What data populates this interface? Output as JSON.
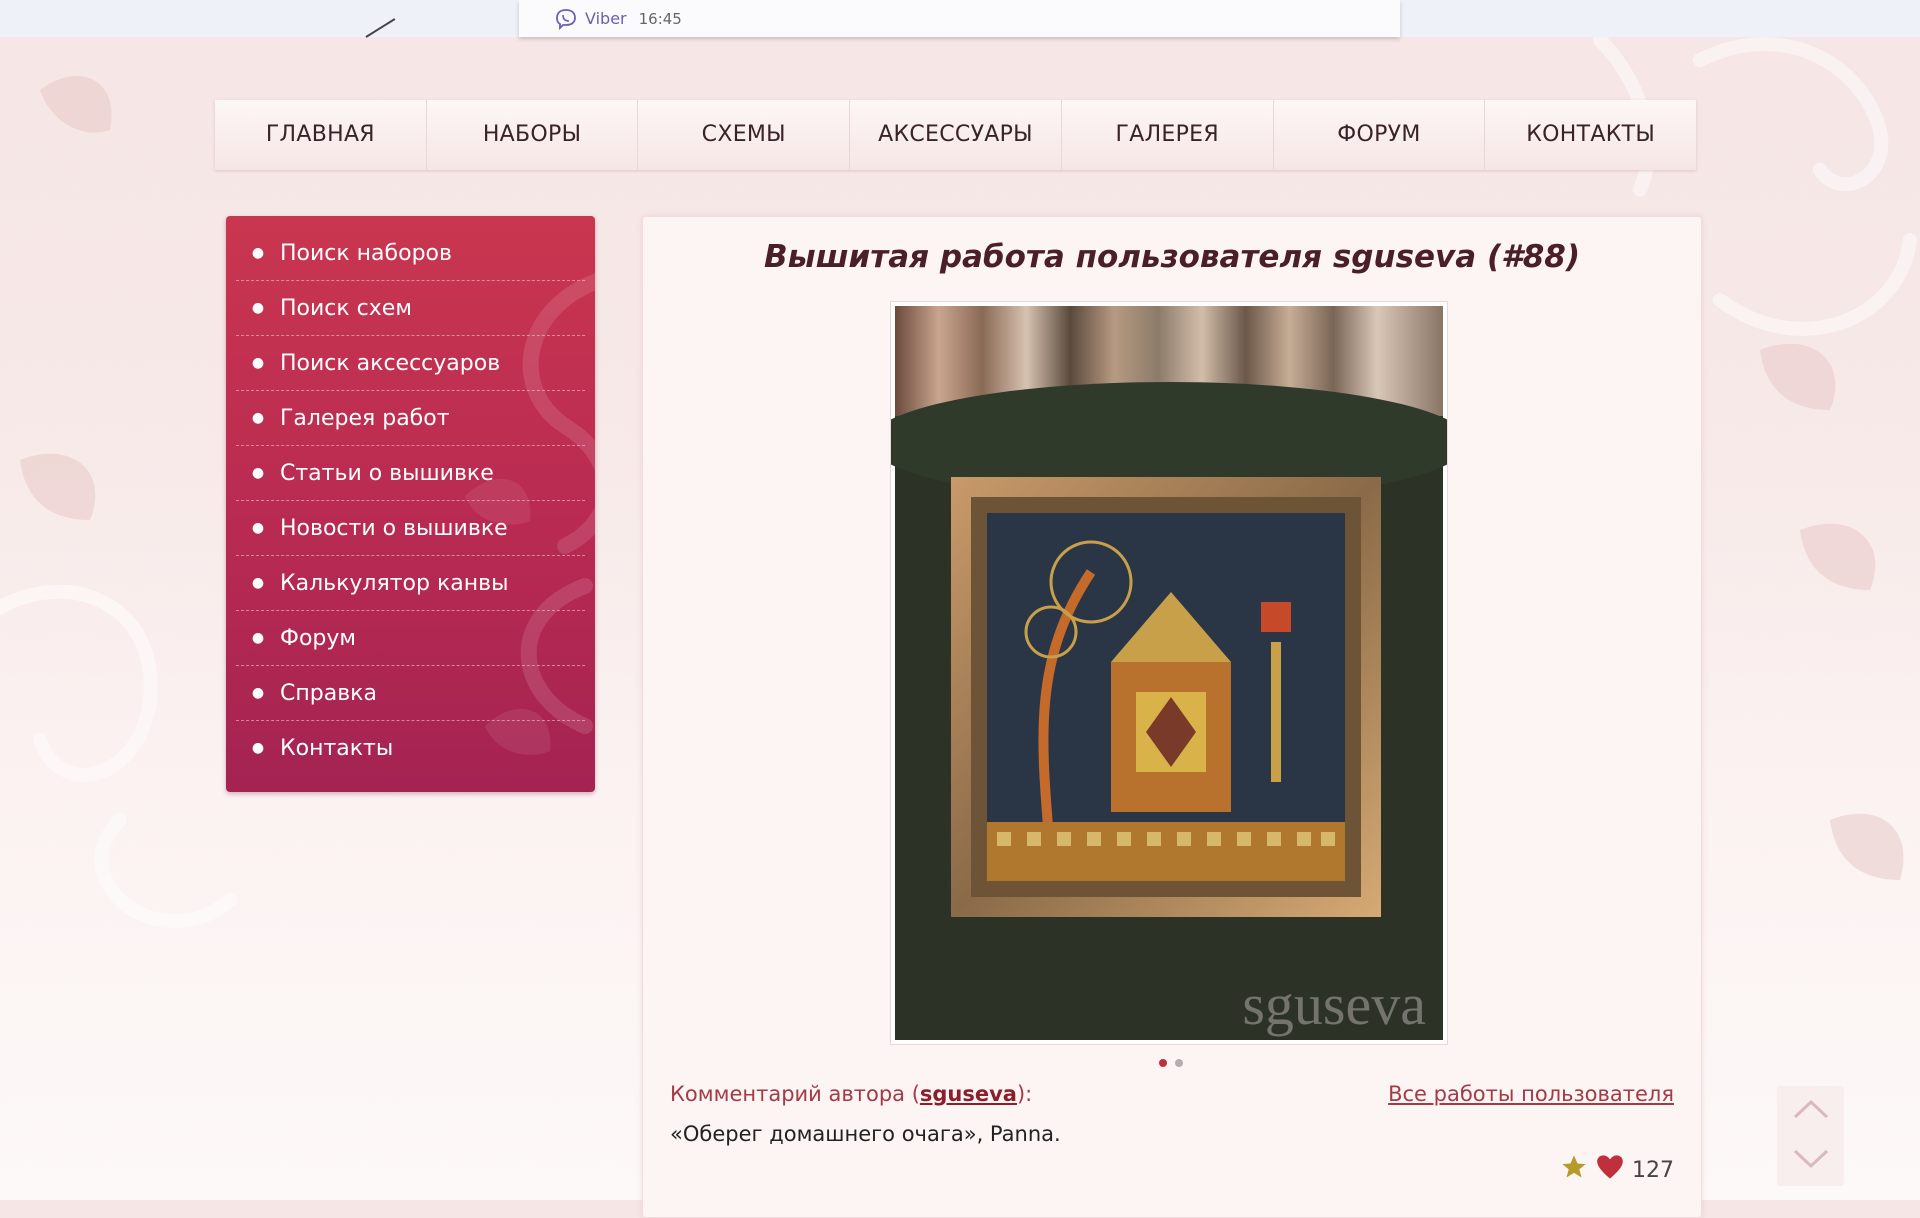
{
  "notification": {
    "app": "Viber",
    "time": "16:45"
  },
  "nav": [
    {
      "label": "ГЛАВНАЯ"
    },
    {
      "label": "НАБОРЫ"
    },
    {
      "label": "СХЕМЫ"
    },
    {
      "label": "АКСЕССУАРЫ"
    },
    {
      "label": "ГАЛЕРЕЯ"
    },
    {
      "label": "ФОРУМ"
    },
    {
      "label": "КОНТАКТЫ"
    }
  ],
  "sidebar": {
    "items": [
      {
        "label": "Поиск наборов"
      },
      {
        "label": "Поиск схем"
      },
      {
        "label": "Поиск аксессуаров"
      },
      {
        "label": "Галерея работ"
      },
      {
        "label": "Статьи о вышивке"
      },
      {
        "label": "Новости о вышивке"
      },
      {
        "label": "Калькулятор канвы"
      },
      {
        "label": "Форум"
      },
      {
        "label": "Справка"
      },
      {
        "label": "Контакты"
      }
    ]
  },
  "main": {
    "title": "Вышитая работа пользователя sguseva (#88)",
    "photo_watermark": "sguseva",
    "slides_total": 2,
    "slide_active": 1,
    "comment_prefix": "Комментарий автора (",
    "comment_user": "sguseva",
    "comment_suffix": "):",
    "all_works_link": "Все работы пользователя",
    "comment_text": "«Оберег домашнего очага», Panna.",
    "likes": "127"
  },
  "colors": {
    "sidebar": "#b82a52",
    "accent": "#a33a46",
    "star": "#b79a2c",
    "heart": "#c0303c",
    "title": "#4a1f2a"
  }
}
